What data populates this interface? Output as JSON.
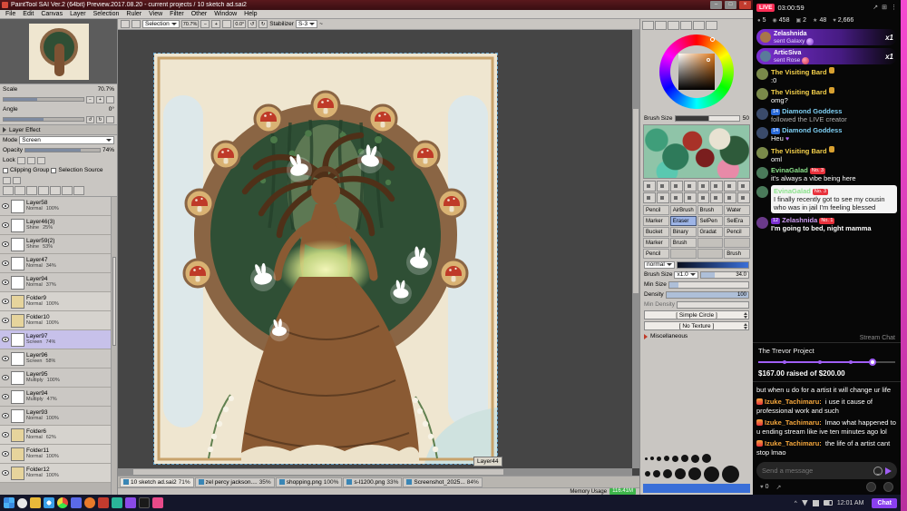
{
  "icons": {
    "minimize": "–",
    "maximize": "□",
    "close": "×",
    "minus": "−",
    "plus": "+",
    "undo": "↺",
    "redo": "↻",
    "check": "✓",
    "tilde": "~",
    "person": "●",
    "eye": "◉",
    "gift": "▣",
    "star": "★",
    "heart": "♥",
    "share": "↗",
    "grid": "⊞",
    "dots": "⋮",
    "caret": "^"
  },
  "sai": {
    "title": "PaintTool SAI Ver.2 (64bit) Preview.2017.08.20 - current projects / 10 sketch ad.sai2",
    "menus": [
      "File",
      "Edit",
      "Canvas",
      "Layer",
      "Selection",
      "Ruler",
      "View",
      "Filter",
      "Other",
      "Window",
      "Help"
    ],
    "toolbar": {
      "selection": "Selection",
      "zoom": "70.7%",
      "angle": "0.0°",
      "stabilizer_label": "Stabilizer",
      "stabilizer": "S-3"
    },
    "navigator": {
      "scale_label": "Scale",
      "scale": "70.7%",
      "angle_label": "Angle",
      "angle": "0°"
    },
    "layer_effect": {
      "header": "Layer Effect",
      "mode_label": "Mode",
      "mode": "Screen",
      "opacity_label": "Opacity",
      "opacity": "74%",
      "lock_label": "Lock",
      "clipping_group": "Clipping Group",
      "selection_source": "Selection Source"
    },
    "layers": [
      {
        "name": "Layer58",
        "mode": "Normal",
        "opacity": "100%"
      },
      {
        "name": "Layer46(3)",
        "mode": "Shine",
        "opacity": "25%"
      },
      {
        "name": "Layer59(2)",
        "mode": "Shine",
        "opacity": "53%"
      },
      {
        "name": "Layer47",
        "mode": "Normal",
        "opacity": "34%"
      },
      {
        "name": "Layer94",
        "mode": "Normal",
        "opacity": "37%"
      },
      {
        "name": "Folder9",
        "mode": "Normal",
        "opacity": "100%"
      },
      {
        "name": "Folder10",
        "mode": "Normal",
        "opacity": "100%"
      },
      {
        "name": "Layer97",
        "mode": "Screen",
        "opacity": "74%"
      },
      {
        "name": "Layer96",
        "mode": "Screen",
        "opacity": "58%"
      },
      {
        "name": "Layer95",
        "mode": "Multiply",
        "opacity": "100%"
      },
      {
        "name": "Layer94",
        "mode": "Multiply",
        "opacity": "47%"
      },
      {
        "name": "Layer93",
        "mode": "Normal",
        "opacity": "100%"
      },
      {
        "name": "Folder6",
        "mode": "Normal",
        "opacity": "62%"
      },
      {
        "name": "Folder11",
        "mode": "Normal",
        "opacity": "100%"
      },
      {
        "name": "Folder12",
        "mode": "Normal",
        "opacity": "100%"
      }
    ],
    "color_panel": {
      "brush_size_label": "Brush Size",
      "brush_size": "50"
    },
    "tool_names": [
      "Pencil",
      "AirBrush",
      "Brush",
      "Water",
      "Marker",
      "Eraser",
      "SelPen",
      "SelEra",
      "Bucket",
      "Binary",
      "Gradat",
      "Pencil",
      "Marker",
      "Brush",
      "",
      "",
      "Pencil",
      "",
      "",
      "Brush"
    ],
    "brush": {
      "blend": "normal",
      "size_label": "Brush Size",
      "size_mult": "x1.0",
      "size": "34.0",
      "min_size_label": "Min Size",
      "density_label": "Density",
      "density": "100",
      "min_density_label": "Min Density",
      "shape": "[ Simple Circle ]",
      "texture": "[ No Texture ]",
      "misc": "Miscellaneous"
    },
    "tabs": [
      {
        "name": "10 sketch ad.sai2",
        "zoom": "71%"
      },
      {
        "name": "zel percy jackson....",
        "zoom": "35%"
      },
      {
        "name": "shopping.png",
        "zoom": "100%"
      },
      {
        "name": "s-l1200.png",
        "zoom": "33%"
      },
      {
        "name": "Screenshot_2025...",
        "zoom": "84%"
      }
    ],
    "status": {
      "memory_label": "Memory Usage",
      "memory": "116.41M"
    },
    "canvas_tooltip": "Layer44"
  },
  "stream": {
    "live": "LIVE",
    "timer": "03:00:59",
    "stats": {
      "viewers": "5",
      "views": "458",
      "gifts": "2",
      "stars": "48",
      "likes_total": "2,666"
    },
    "gifts": [
      {
        "user": "Zelashnida",
        "action": "sent Galaxy",
        "count": "x1"
      },
      {
        "user": "ArticSiva",
        "action": "sent Rose",
        "count": "x1"
      }
    ],
    "messages": [
      {
        "user": "The Visiting Bard",
        "text": ":0"
      },
      {
        "user": "The Visiting Bard",
        "text": "omg?"
      },
      {
        "user": "Diamond Goddess",
        "badge": "14",
        "text": "followed the LIVE creator"
      },
      {
        "user": "Diamond Goddess",
        "badge": "14",
        "text": "Heu"
      },
      {
        "user": "The Visiting Bard",
        "text": "oml"
      },
      {
        "user": "EvinaGalad",
        "badge": "No. 3",
        "text": "it's always a vibe being here"
      },
      {
        "user": "EvinaGalad",
        "badge": "No. 3",
        "text": "I finally recently got to see my cousin who was in jail I'm feeling blessed"
      },
      {
        "user": "Zelashnida",
        "badge": "12",
        "badge2": "No. 1",
        "text": "I'm going to bed, night mamma"
      }
    ],
    "overlay_label": "Stream Chat",
    "fundraiser": {
      "title": "The Trevor Project",
      "raised": "$167.00 raised of $200.00"
    },
    "chat2": [
      {
        "user": "",
        "text": "but when u do for a artist it will change ur life"
      },
      {
        "user": "Izuke_Tachimaru:",
        "text": "i use it cause of professional work and such"
      },
      {
        "user": "Izuke_Tachimaru:",
        "text": "lmao what happened to u ending stream like ive ten minutes ago lol"
      },
      {
        "user": "Izuke_Tachimaru:",
        "text": "the life of a artist cant stop lmao"
      }
    ],
    "input_placeholder": "Send a message",
    "likes": "0",
    "chat_button": "Chat"
  },
  "taskbar": {
    "time": "12:01 AM"
  },
  "colors": {
    "accent_purple": "#9147ff",
    "live_red": "#fe2c55",
    "name_yellow": "#f3cf4a",
    "name_blue": "#7ed0f5",
    "name_green": "#8be28b",
    "name_purple": "#cf9df5",
    "name_orange": "#f5a63c",
    "memory_green": "#3db54a"
  }
}
